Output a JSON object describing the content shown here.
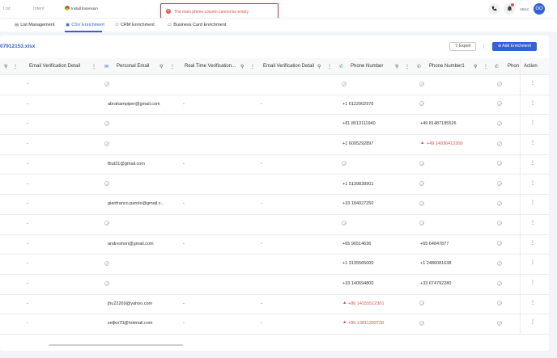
{
  "topbar": {
    "nav": [
      "List",
      "Intent"
    ],
    "extension_label": "Install Extension",
    "toast_message": "The main phone column cannot be empty",
    "phone_icon": "phone-icon",
    "bell_icon": "bell-icon",
    "credits": "CEDC",
    "avatar_text": "GO"
  },
  "tabs": [
    {
      "icon": "list-icon",
      "label": "List Management"
    },
    {
      "icon": "csv-icon",
      "label": "CSV Enrichment"
    },
    {
      "icon": "crm-icon",
      "label": "CRM Enrichment"
    },
    {
      "icon": "card-icon",
      "label": "Business Card Enrichment"
    }
  ],
  "toolbar": {
    "filename": "07912153.xlsx",
    "export_label": "Export",
    "add_label": "Add Enrichment"
  },
  "columns": {
    "email_verification_1": "Email Verification Detail",
    "personal_email": "Personal Email",
    "real_time_verification": "Real Time Verification...",
    "email_verification_2": "Email Verification Detail",
    "phone_number": "Phone Number",
    "phone_number1": "Phone Number1",
    "phone_cut": "Phon",
    "action": "Action"
  },
  "rows": [
    {
      "ev1": "-",
      "email": null,
      "rtv": "",
      "ev2": "",
      "phone": null,
      "phone_red": false,
      "phone1": null,
      "phone1_red": false
    },
    {
      "ev1": "-",
      "email": "abrahampiper@gmail.com",
      "rtv": "-",
      "ev2": "-",
      "phone": "+1 6122002976",
      "phone_red": false,
      "phone1": null,
      "phone1_red": false
    },
    {
      "ev1": "-",
      "email": null,
      "rtv": "",
      "ev2": "",
      "phone": "+81 8013111940",
      "phone_red": false,
      "phone1": "+49 81487185526",
      "phone1_red": false
    },
    {
      "ev1": "-",
      "email": null,
      "rtv": "",
      "ev2": "",
      "phone": "+1 6095292897",
      "phone_red": false,
      "phone1": "+49 14936412200",
      "phone1_red": true
    },
    {
      "ev1": "-",
      "email": "fbut31@gmail.com",
      "rtv": "-",
      "ev2": "-",
      "phone": null,
      "phone_red": false,
      "phone1": null,
      "phone1_red": false
    },
    {
      "ev1": "-",
      "email": null,
      "rtv": "",
      "ev2": "",
      "phone": "+1 5139838901",
      "phone_red": false,
      "phone1": null,
      "phone1_red": false
    },
    {
      "ev1": "-",
      "email": "gianfranco.parolo@gmail.c...",
      "rtv": "-",
      "ev2": "-",
      "phone": "+33 184027250",
      "phone_red": false,
      "phone1": null,
      "phone1_red": false
    },
    {
      "ev1": "-",
      "email": null,
      "rtv": "",
      "ev2": "",
      "phone": null,
      "phone_red": false,
      "phone1": null,
      "phone1_red": false
    },
    {
      "ev1": "-",
      "email": "andreshori@gmail.com",
      "rtv": "-",
      "ev2": "-",
      "phone": "+65 96514636",
      "phone_red": false,
      "phone1": "+65 64847877",
      "phone1_red": false
    },
    {
      "ev1": "-",
      "email": null,
      "rtv": "",
      "ev2": "",
      "phone": "+1 3135565000",
      "phone_red": false,
      "phone1": "+1 2486081638",
      "phone1_red": false
    },
    {
      "ev1": "-",
      "email": null,
      "rtv": "",
      "ev2": "",
      "phone": "+33 140694800",
      "phone_red": false,
      "phone1": "+33 674792280",
      "phone1_red": false
    },
    {
      "ev1": "-",
      "email": "jhu22269@yahoo.com",
      "rtv": "-",
      "ev2": "-",
      "phone": "+86 14155512301",
      "phone_red": true,
      "phone1": null,
      "phone1_red": false
    },
    {
      "ev1": "-",
      "email": "zeljko70@hotmail.com",
      "rtv": "-",
      "ev2": "-",
      "phone": "+86 13811299728",
      "phone_red": true,
      "phone1": null,
      "phone1_red": false
    }
  ],
  "colors": {
    "accent": "#3361d8",
    "error": "#e05050",
    "phone_icon": "#2e9d4a"
  }
}
